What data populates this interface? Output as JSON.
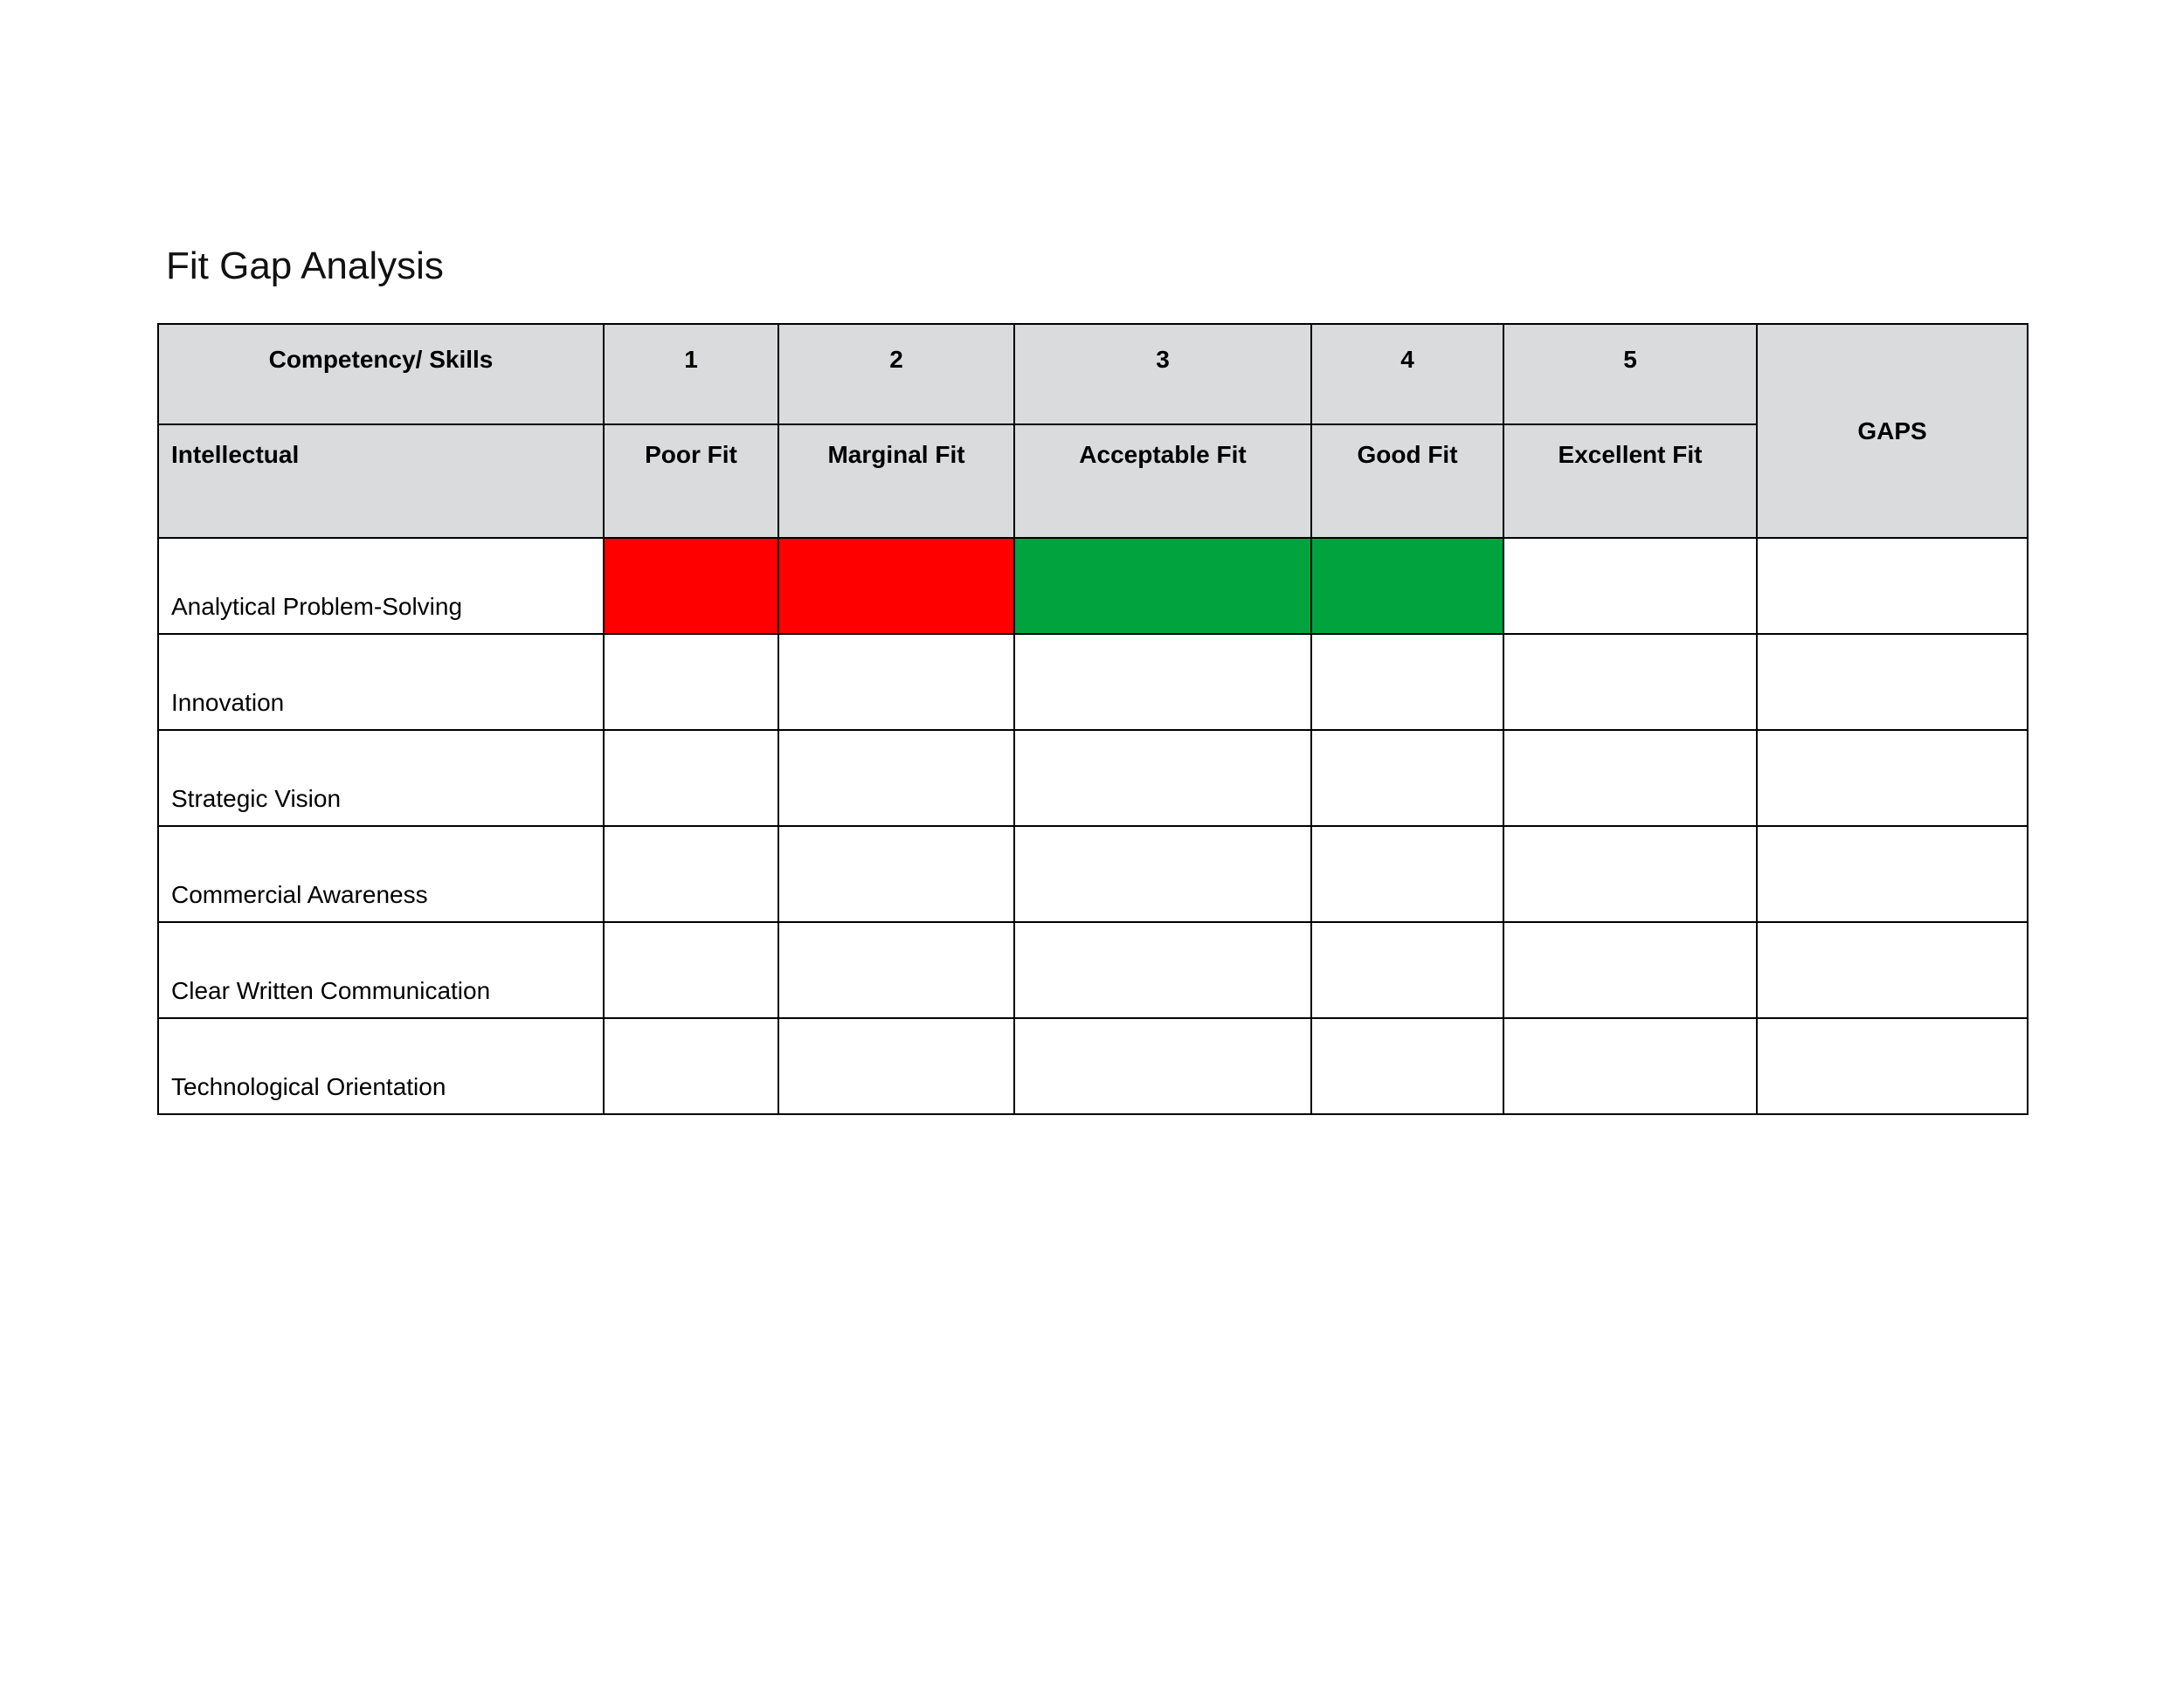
{
  "title": "Fit Gap Analysis",
  "headers": {
    "competency": "Competency/ Skills",
    "gaps": "GAPS",
    "section": "Intellectual",
    "scale": [
      {
        "num": "1",
        "label": "Poor Fit"
      },
      {
        "num": "2",
        "label": "Marginal Fit"
      },
      {
        "num": "3",
        "label": "Acceptable Fit"
      },
      {
        "num": "4",
        "label": "Good Fit"
      },
      {
        "num": "5",
        "label": "Excellent Fit"
      }
    ]
  },
  "colors": {
    "header_bg": "#dadbdc",
    "red": "#ff0000",
    "green": "#00a33e"
  },
  "rows": [
    {
      "label": "Analytical Problem-Solving",
      "cells": [
        "red",
        "red",
        "green",
        "green",
        ""
      ],
      "gaps": ""
    },
    {
      "label": "Innovation",
      "cells": [
        "",
        "",
        "",
        "",
        ""
      ],
      "gaps": ""
    },
    {
      "label": "Strategic Vision",
      "cells": [
        "",
        "",
        "",
        "",
        ""
      ],
      "gaps": ""
    },
    {
      "label": "Commercial Awareness",
      "cells": [
        "",
        "",
        "",
        "",
        ""
      ],
      "gaps": ""
    },
    {
      "label": "Clear Written Communication",
      "cells": [
        "",
        "",
        "",
        "",
        ""
      ],
      "gaps": ""
    },
    {
      "label": "Technological Orientation",
      "cells": [
        "",
        "",
        "",
        "",
        ""
      ],
      "gaps": ""
    }
  ]
}
